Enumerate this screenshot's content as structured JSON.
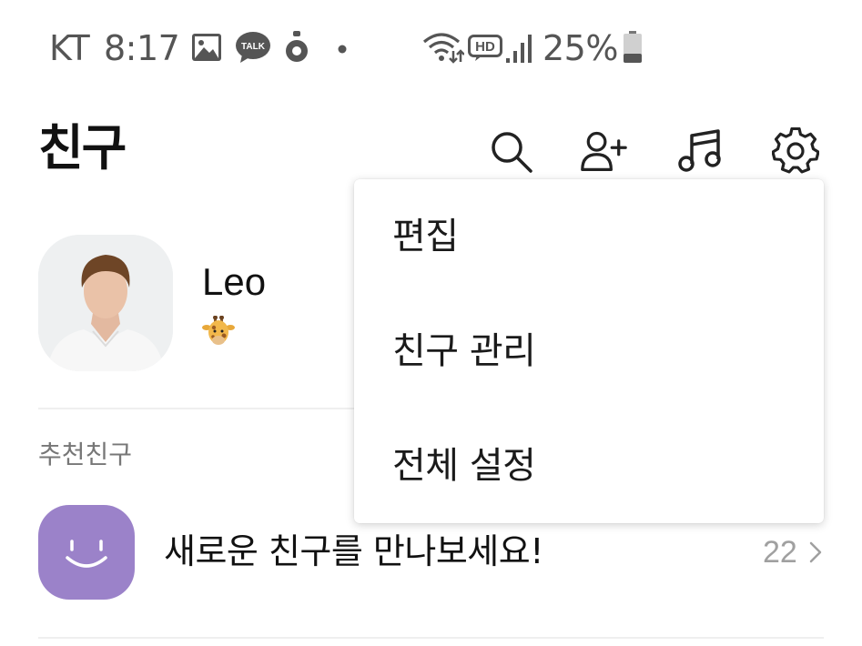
{
  "status_bar": {
    "carrier": "KT",
    "time": "8:17",
    "battery": "25%",
    "notification_icons": [
      "image-icon",
      "kakaotalk-icon",
      "location-icon",
      "dot-icon"
    ],
    "system_icons": [
      "wifi-icon",
      "hd-voice-icon",
      "signal-icon",
      "battery-icon"
    ],
    "talk_badge": "TALK",
    "hd_badge": "HD"
  },
  "header": {
    "title": "친구",
    "icons": [
      "search-icon",
      "add-friend-icon",
      "music-icon",
      "settings-icon"
    ]
  },
  "profile": {
    "name": "Leo",
    "status_emoji": "giraffe-emoji"
  },
  "recommended": {
    "section_label": "추천친구",
    "item_text": "새로운 친구를 만나보세요!",
    "count": "22",
    "avatar_color": "#9b82c9"
  },
  "settings_menu": {
    "items": [
      "편집",
      "친구 관리",
      "전체 설정"
    ]
  }
}
